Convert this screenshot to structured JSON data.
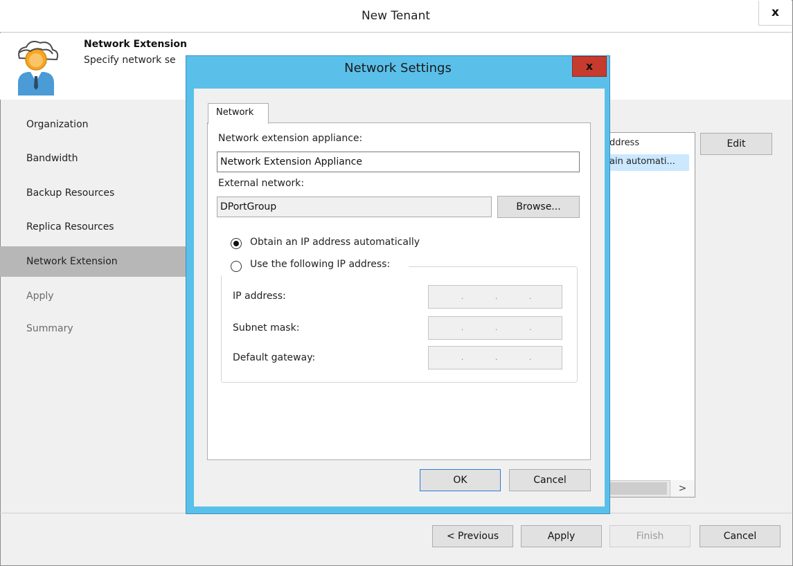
{
  "window": {
    "title": "New Tenant",
    "close_glyph": "x"
  },
  "header": {
    "title": "Network Extension",
    "subtitle": "Specify network se",
    "icon": "tenant-cloud-user-icon"
  },
  "steps": [
    {
      "label": "Organization",
      "state": "done"
    },
    {
      "label": "Bandwidth",
      "state": "done"
    },
    {
      "label": "Backup Resources",
      "state": "done"
    },
    {
      "label": "Replica Resources",
      "state": "done"
    },
    {
      "label": "Network Extension",
      "state": "active"
    },
    {
      "label": "Apply",
      "state": "disabled"
    },
    {
      "label": "Summary",
      "state": "disabled"
    }
  ],
  "background_list": {
    "header": "ddress",
    "row": "ain automati...",
    "scroll_right_glyph": ">"
  },
  "edit_button": "Edit",
  "footer": {
    "previous": "< Previous",
    "apply": "Apply",
    "finish": "Finish",
    "cancel": "Cancel"
  },
  "dialog": {
    "title": "Network Settings",
    "close_glyph": "x",
    "tab": "Network",
    "appliance_label": "Network extension appliance:",
    "appliance_value": "Network Extension Appliance",
    "external_network_label": "External network:",
    "external_network_value": "DPortGroup",
    "browse": "Browse...",
    "radio_auto": "Obtain an IP address automatically",
    "radio_manual": "Use the following IP address:",
    "radio_selected": "auto",
    "ip_label": "IP address:",
    "subnet_label": "Subnet mask:",
    "gateway_label": "Default gateway:",
    "ok": "OK",
    "cancel": "Cancel"
  },
  "colors": {
    "dialog_frame": "#5ac0e9",
    "close_red": "#c73b2f",
    "active_step": "#b7b7b7",
    "selection": "#cce8ff"
  }
}
